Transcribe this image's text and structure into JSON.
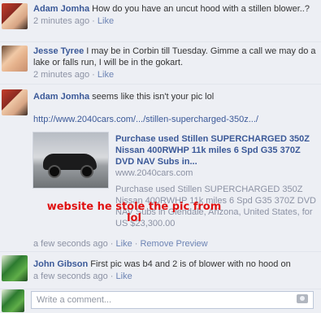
{
  "comments": [
    {
      "author": "Adam Jomha",
      "text": "How do you have an uncut hood with a stillen blower..?",
      "time": "2 minutes ago",
      "like": "Like"
    },
    {
      "author": "Jesse Tyree",
      "text": "I may be in Corbin till Tuesday. Gimme a call we may do a lake or falls run, I will be in the gokart.",
      "time": "2 minutes ago",
      "like": "Like"
    },
    {
      "author": "Adam Jomha",
      "text": "seems like this isn't your pic lol",
      "url": "http://www.2040cars.com/.../stillen-supercharged-350z.../",
      "time": "a few seconds ago",
      "like": "Like",
      "remove": "Remove Preview",
      "preview": {
        "title": "Purchase used Stillen SUPERCHARGED 350Z Nissan 400RWHP 11k miles 6 Spd G35 370Z DVD NAV Subs in...",
        "site": "www.2040cars.com",
        "description": "Purchase used Stillen SUPERCHARGED 350Z Nissan 400RWHP 11k miles 6 Spd G35 370Z DVD NAV Subs in Glendale, Arizona, United States, for US $23,300.00"
      }
    },
    {
      "author": "John Gibson",
      "text": "First pic was b4 and 2 is of blower with no hood on",
      "time": "a few seconds ago",
      "like": "Like"
    }
  ],
  "annotation": "website he stole the pic from lol",
  "compose": {
    "placeholder": "Write a comment..."
  }
}
